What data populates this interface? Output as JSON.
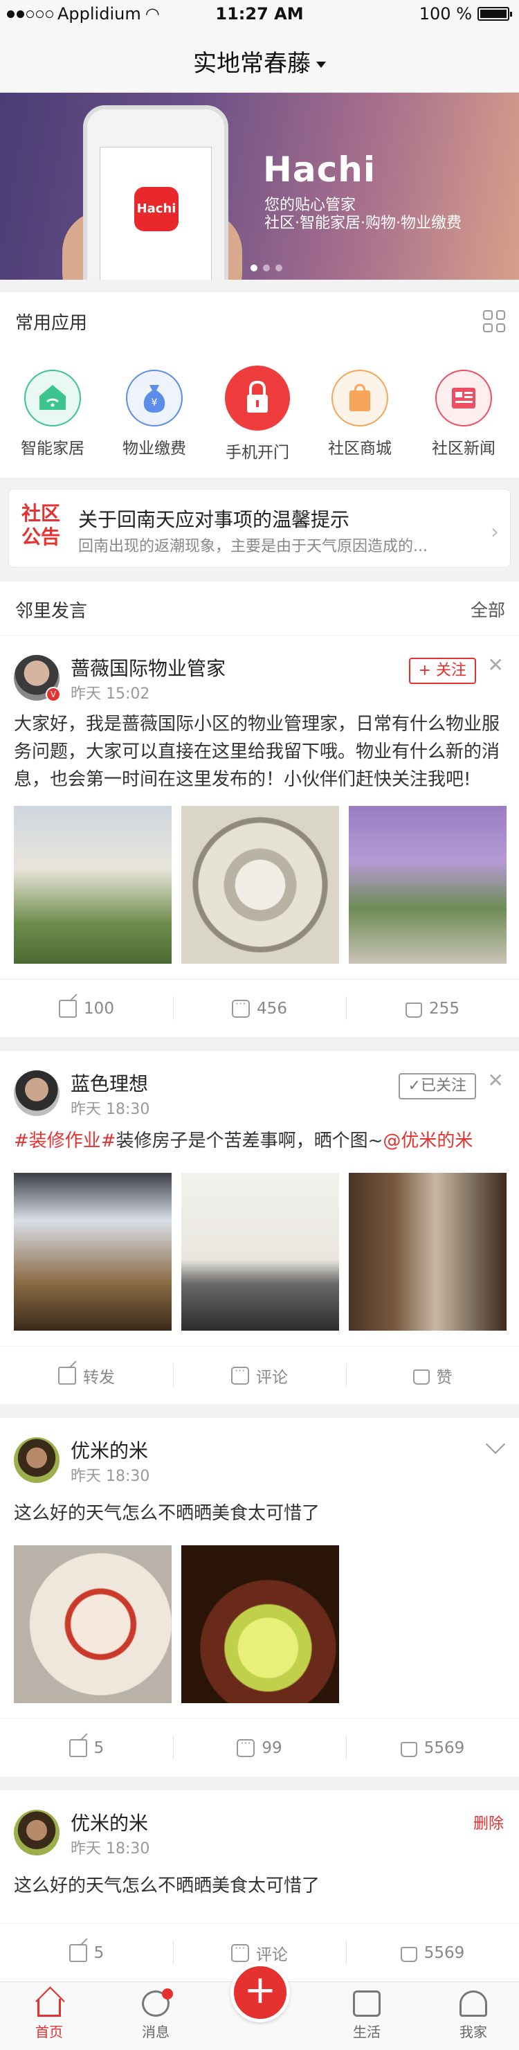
{
  "status_bar": {
    "carrier": "Applidium",
    "time": "11:27 AM",
    "battery": "100 %"
  },
  "nav": {
    "title": "实地常春藤"
  },
  "banner": {
    "app_icon_text": "Hachi",
    "brand": "Hachi",
    "tagline1": "您的贴心管家",
    "tagline2": "社区·智能家居·购物·物业缴费"
  },
  "apps": {
    "title": "常用应用",
    "items": [
      {
        "label": "智能家居",
        "icon": "wifi-home-icon"
      },
      {
        "label": "物业缴费",
        "icon": "money-bag-icon"
      },
      {
        "label": "手机开门",
        "icon": "lock-icon"
      },
      {
        "label": "社区商城",
        "icon": "shopping-bag-icon"
      },
      {
        "label": "社区新闻",
        "icon": "news-icon"
      }
    ]
  },
  "notice": {
    "badge": "社区公告",
    "title": "关于回南天应对事项的温馨提示",
    "desc": "回南出现的返潮现象，主要是由于天气原因造成的..."
  },
  "feed": {
    "title": "邻里发言",
    "all": "全部"
  },
  "posts": [
    {
      "name": "蔷薇国际物业管家",
      "time": "昨天 15:02",
      "follow": "+ 关注",
      "content": "大家好，我是蔷薇国际小区的物业管理家，日常有什么物业服务问题，大家可以直接在这里给我留下哦。物业有什么新的消息，也会第一时间在这里发布的！小伙伴们赶快关注我吧!",
      "share": "100",
      "comment": "456",
      "like": "255"
    },
    {
      "name": "蓝色理想",
      "time": "昨天 18:30",
      "follow": "✓已关注",
      "tag": "#装修作业#",
      "content": "装修房子是个苦差事啊，晒个图~",
      "mention": "@优米的米",
      "share": "转发",
      "comment": "评论",
      "like": "赞"
    },
    {
      "name": "优米的米",
      "time": "昨天 18:30",
      "content": "这么好的天气怎么不晒晒美食太可惜了",
      "share": "5",
      "comment": "99",
      "like": "5569"
    },
    {
      "name": "优米的米",
      "time": "昨天 18:30",
      "delete": "删除",
      "content": "这么好的天气怎么不晒晒美食太可惜了",
      "share": "5",
      "comment": "评论",
      "like": "5569"
    }
  ],
  "tabbar": {
    "home": "首页",
    "messages": "消息",
    "life": "生活",
    "me": "我家",
    "plus": "+"
  },
  "colors": {
    "accent": "#e5312f"
  }
}
